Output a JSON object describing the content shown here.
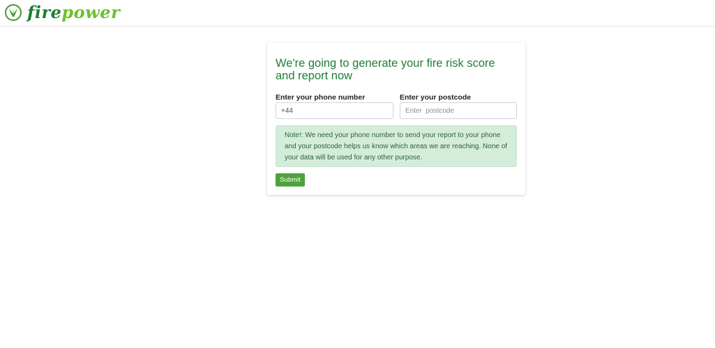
{
  "brand": {
    "logo_part1": "fire",
    "logo_part2": "power",
    "primary_color": "#1e7d36",
    "secondary_color": "#6cbf2a"
  },
  "form": {
    "title": "We're going to generate your fire risk score and report now",
    "phone": {
      "label": "Enter your phone number",
      "value": "+44"
    },
    "postcode": {
      "label": "Enter your postcode",
      "placeholder": "Enter  postcode"
    },
    "note": "Note!: We need your phone number to send your report to your phone and your postcode helps us know which areas we are reaching. None of your data will be used for any other purpose.",
    "submit_label": "Submit",
    "submit_color": "#4ea23b",
    "note_bg_color": "#d4edda"
  }
}
